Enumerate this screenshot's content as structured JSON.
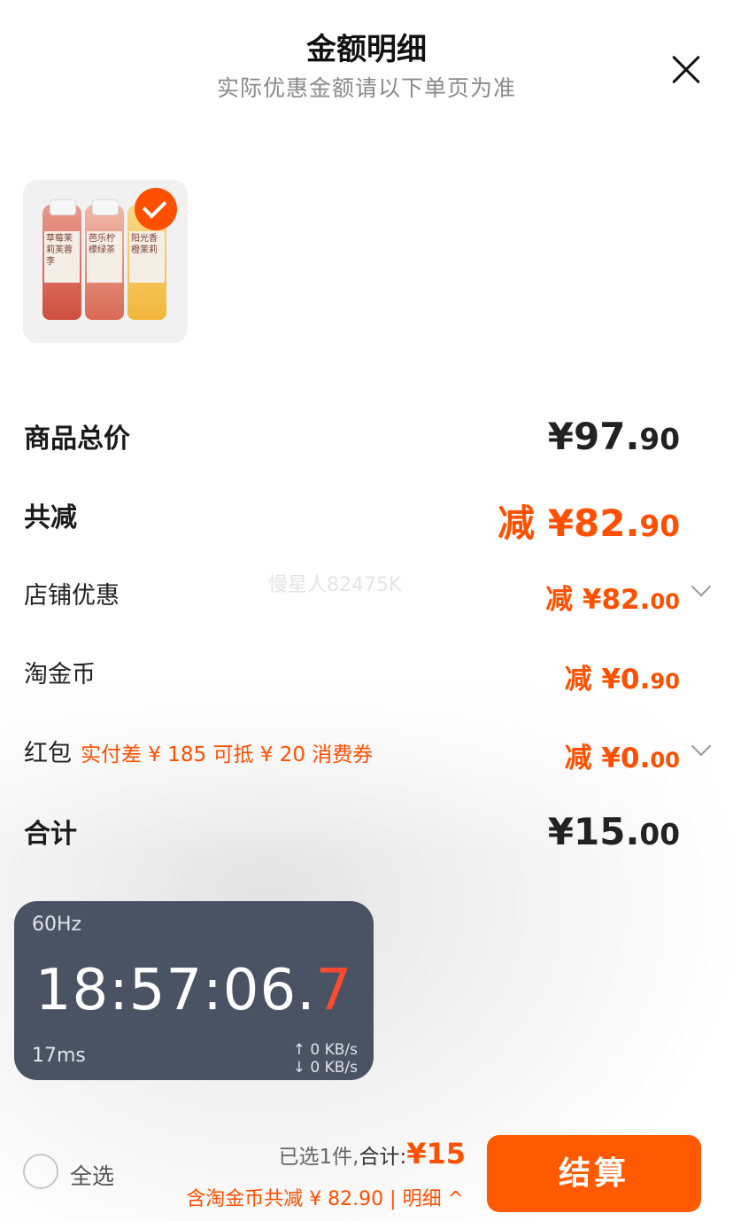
{
  "header": {
    "title": "金额明细",
    "subtitle": "实际优惠金额请以下单页为准"
  },
  "product": {
    "bottles": [
      "草莓茉莉芙蓉李",
      "芭乐柠檬绿茶",
      "阳光香橙茉莉"
    ]
  },
  "rows": {
    "total": {
      "label": "商品总价",
      "int": "¥97.",
      "dec": "90"
    },
    "discount": {
      "label": "共减",
      "int": "减 ¥82.",
      "dec": "90"
    },
    "shop": {
      "label": "店铺优惠",
      "int": "减 ¥82.",
      "dec": "00"
    },
    "coins": {
      "label": "淘金币",
      "int": "减 ¥0.",
      "dec": "90"
    },
    "hongbao": {
      "label": "红包",
      "note": "实付差 ¥ 185 可抵 ¥ 20 消费券",
      "int": "减 ¥0.",
      "dec": "00"
    },
    "sum": {
      "label": "合计",
      "int": "¥15.",
      "dec": "00"
    }
  },
  "watermark": "慢星人82475K",
  "overlay": {
    "hz": "60Hz",
    "time_main": "18:57:06.",
    "time_tenth": "7",
    "ms": "17ms",
    "up": "↑ 0 KB/s",
    "down": "↓ 0 KB/s"
  },
  "footer": {
    "select_all": "全选",
    "selected_text": "已选1件,",
    "sum_label": "合计:",
    "sum_amount": "¥15",
    "sub_text": "含淘金币共减 ¥ 82.90 | 明细 ^",
    "checkout": "结算"
  },
  "colors": {
    "accent": "#ff5000",
    "overlay_bg": "#4a5364"
  }
}
